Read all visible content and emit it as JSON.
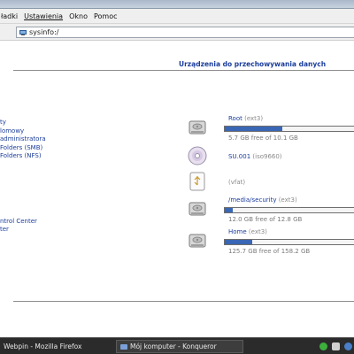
{
  "menubar": {
    "items": [
      "ładki",
      "Ustawienia",
      "Okno",
      "Pomoc"
    ]
  },
  "location": {
    "url": "sysinfo:/"
  },
  "left_links": [
    "ty",
    "lomowy",
    "administratora",
    "Folders (SMB)",
    "Folders (NFS)",
    "ntrol Center",
    "ter"
  ],
  "storage": {
    "heading": "Urządzenia do przechowywania danych",
    "devices": [
      {
        "name": "Root",
        "fs": "(ext3)",
        "free": "5.7 GB free of 10.1 GB",
        "used_fraction": 0.44,
        "icon": "hard-disk-icon"
      },
      {
        "name": "SU.001",
        "fs": "(iso9660)",
        "free": "",
        "used_fraction": null,
        "icon": "cd-rom-icon"
      },
      {
        "name": "",
        "fs": "(vfat)",
        "free": "",
        "used_fraction": null,
        "icon": "usb-drive-icon"
      },
      {
        "name": "/media/security",
        "fs": "(ext3)",
        "free": "12.0 GB free of 12.8 GB",
        "used_fraction": 0.06,
        "icon": "hard-disk-icon"
      },
      {
        "name": "Home",
        "fs": "(ext3)",
        "free": "125.7 GB free of 158.2 GB",
        "used_fraction": 0.21,
        "icon": "hard-disk-icon"
      }
    ]
  },
  "taskbar": {
    "firefox": "Webpin - Mozilla Firefox",
    "konqueror": "Mój komputer - Konqueror"
  },
  "colors": {
    "link": "#1b3d9c",
    "bar_fill": "#3a67b5",
    "taskbar": "#2b2b2b"
  }
}
